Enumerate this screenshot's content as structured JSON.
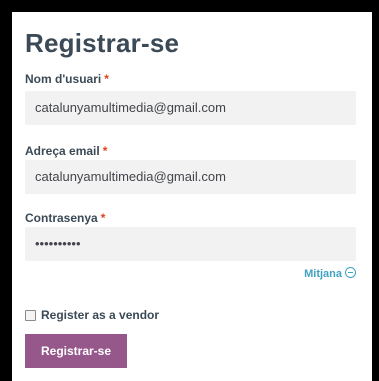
{
  "form": {
    "title": "Registrar-se",
    "required_marker": "*",
    "username": {
      "label": "Nom d'usuari",
      "value": "catalunyamultimedia@gmail.com"
    },
    "email": {
      "label": "Adreça email",
      "value": "catalunyamultimedia@gmail.com"
    },
    "password": {
      "label": "Contrasenya",
      "value": "••••••••••",
      "strength": "Mitjana"
    },
    "vendor_checkbox": {
      "label": "Register as a vendor",
      "checked": false
    },
    "submit_label": "Registrar-se"
  },
  "colors": {
    "heading": "#3b4a56",
    "required": "#e2401c",
    "field_bg": "#f2f2f2",
    "strength": "#42a2c4",
    "button": "#96588a"
  }
}
